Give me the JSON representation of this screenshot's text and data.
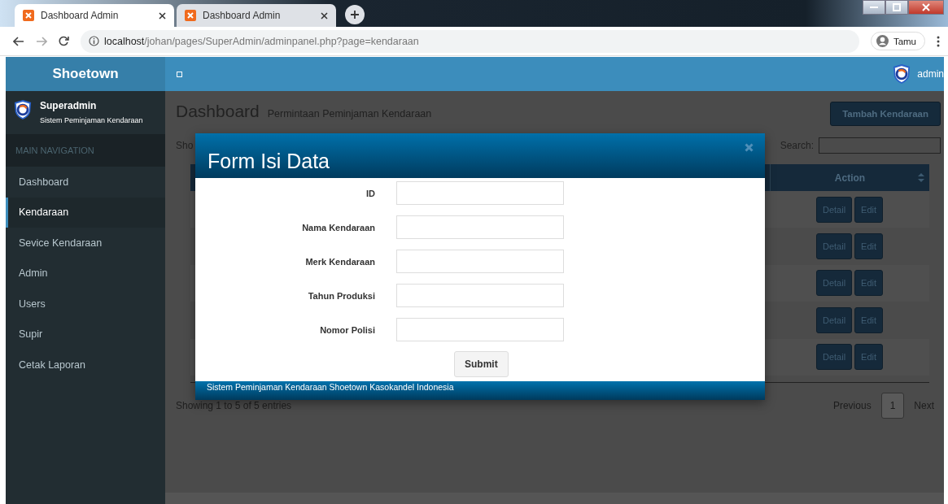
{
  "browser": {
    "tabs": [
      {
        "title": "Dashboard Admin",
        "selected": true
      },
      {
        "title": "Dashboard Admin",
        "selected": false
      }
    ],
    "url": {
      "host": "localhost",
      "path": "/johan/pages/SuperAdmin/adminpanel.php?page=kendaraan"
    },
    "profile": "Tamu"
  },
  "header": {
    "brand": "Shoetown",
    "user": "admin"
  },
  "sidebar": {
    "user_name": "Superadmin",
    "user_subtitle": "Sistem Peminjaman Kendaraan",
    "section": "MAIN NAVIGATION",
    "items": [
      {
        "label": "Dashboard",
        "selected": false
      },
      {
        "label": "Kendaraan",
        "selected": true
      },
      {
        "label": "Sevice Kendaraan",
        "selected": false
      },
      {
        "label": "Admin",
        "selected": false
      },
      {
        "label": "Users",
        "selected": false
      },
      {
        "label": "Supir",
        "selected": false
      },
      {
        "label": "Cetak Laporan",
        "selected": false
      }
    ]
  },
  "content": {
    "title": "Dashboard",
    "subtitle": "Permintaan Peminjaman Kendaraan",
    "add_button": "Tambah Kendaraan",
    "length_label": "Sho",
    "search_label": "Search:",
    "table": {
      "columns": [
        "Action"
      ],
      "rows": [
        {
          "actions": [
            "Detail",
            "Edit"
          ]
        },
        {
          "actions": [
            "Detail",
            "Edit"
          ]
        },
        {
          "actions": [
            "Detail",
            "Edit"
          ]
        },
        {
          "actions": [
            "Detail",
            "Edit"
          ]
        },
        {
          "actions": [
            "Detail",
            "Edit"
          ]
        }
      ]
    },
    "info": "Showing 1 to 5 of 5 entries",
    "pagination": {
      "previous": "Previous",
      "pages": [
        {
          "label": "1",
          "selected": true
        }
      ],
      "next": "Next"
    }
  },
  "modal": {
    "title": "Form Isi Data",
    "fields": [
      {
        "label": "ID"
      },
      {
        "label": "Nama Kendaraan"
      },
      {
        "label": "Merk Kendaraan"
      },
      {
        "label": "Tahun Produksi"
      },
      {
        "label": "Nomor Polisi"
      }
    ],
    "submit": "Submit",
    "footer": "Sistem Peminjaman Kendaraan Shoetown Kasokandel Indonesia"
  }
}
